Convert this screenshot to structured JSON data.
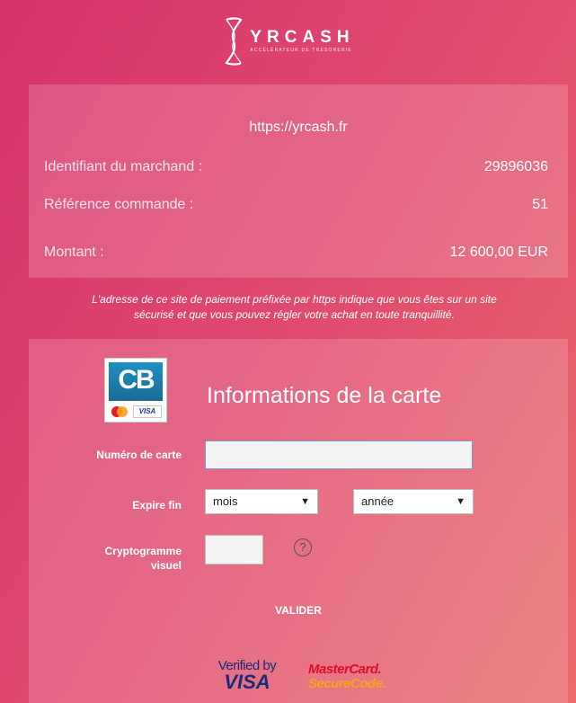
{
  "brand": {
    "name": "YRCASH",
    "tagline": "ACCÉLÉRATEUR DE TRÉSORERIE"
  },
  "summary": {
    "site_url": "https://yrcash.fr",
    "merchant_label": "Identifiant du marchand :",
    "merchant_value": "29896036",
    "order_label": "Référence commande :",
    "order_value": "51",
    "amount_label": "Montant :",
    "amount_value": "12 600,00 EUR"
  },
  "notice": {
    "line1": "L'adresse de ce site de paiement préfixée par https indique que vous êtes sur un site",
    "line2": "sécurisé et que vous pouvez régler votre achat en toute tranquillité."
  },
  "card_form": {
    "cb_logo_text": "CB",
    "visa_mini_text": "VISA",
    "title": "Informations de la carte",
    "card_number_label": "Numéro de carte",
    "card_number_value": "",
    "expiry_label": "Expire fin",
    "month_selected": "mois",
    "year_selected": "année",
    "cvv_label_line1": "Cryptogramme",
    "cvv_label_line2": "visuel",
    "cvv_value": "",
    "help_icon_text": "?",
    "submit_label": "VALIDER"
  },
  "badges": {
    "verified_by": "Verified by",
    "visa": "VISA",
    "mastercard": "MasterCard.",
    "securecode": "SecureCode."
  },
  "colors": {
    "background_start": "#d6336c",
    "background_end": "#ea6a6a",
    "panel_overlay": "rgba(255,255,255,0.17)",
    "input_focus_border": "#7e95c9"
  }
}
